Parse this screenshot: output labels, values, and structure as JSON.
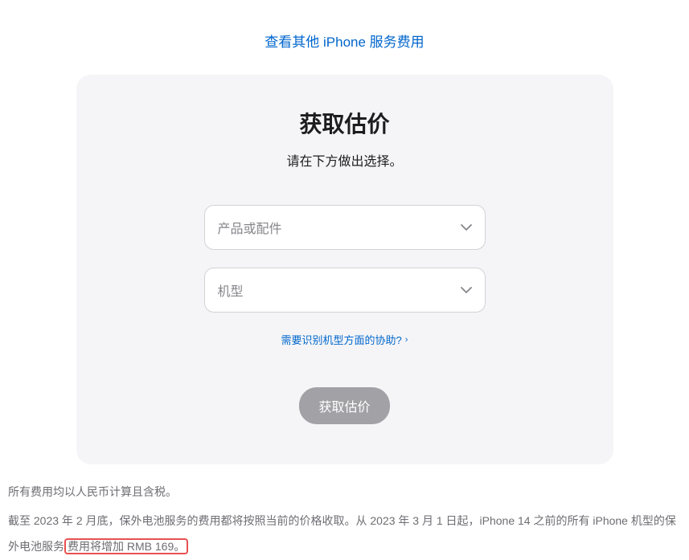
{
  "topLink": "查看其他 iPhone 服务费用",
  "card": {
    "title": "获取估价",
    "subtitle": "请在下方做出选择。",
    "select1Placeholder": "产品或配件",
    "select2Placeholder": "机型",
    "helpLink": "需要识别机型方面的协助?",
    "buttonLabel": "获取估价"
  },
  "footer": {
    "line1": "所有费用均以人民币计算且含税。",
    "line2Part1": "截至 2023 年 2 月底，保外电池服务的费用都将按照当前的价格收取。从 2023 年 3 月 1 日起，iPhone 14 之前的所有 iPhone 机型的保外电池服务",
    "line2Highlighted": "费用将增加 RMB 169。"
  }
}
